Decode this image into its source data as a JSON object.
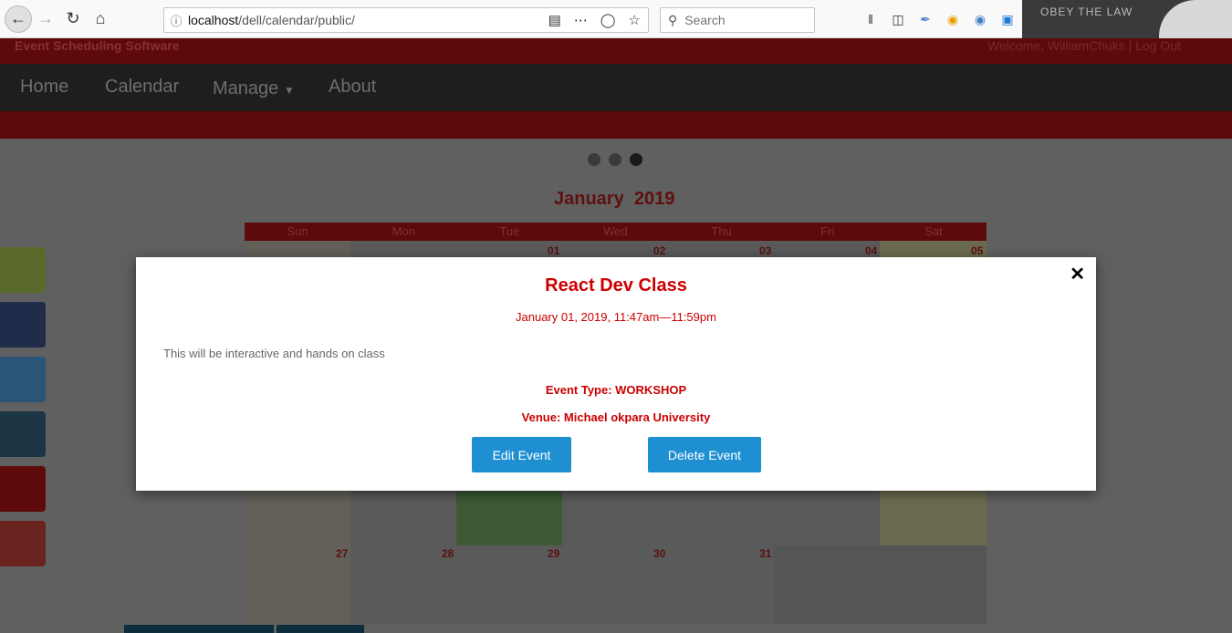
{
  "browser": {
    "url_host": "localhost",
    "url_path": "/dell/calendar/public/",
    "search_placeholder": "Search"
  },
  "header": {
    "brand": "Event Scheduling Software",
    "welcome": "Welcome, WilliamChuks | Log Out"
  },
  "nav": {
    "items": [
      "Home",
      "Calendar",
      "Manage",
      "About"
    ]
  },
  "calendar": {
    "month": "January",
    "year": "2019",
    "weekdays": [
      "Sun",
      "Mon",
      "Tue",
      "Wed",
      "Thu",
      "Fri",
      "Sat"
    ],
    "first_row_days": [
      "01",
      "02",
      "03",
      "04",
      "05"
    ],
    "last_row_days": [
      "27",
      "28",
      "29",
      "30",
      "31"
    ]
  },
  "modal": {
    "title": "React Dev Class",
    "when": "January 01, 2019, 11:47am—11:59pm",
    "description": "This will be interactive and hands on class",
    "event_type": "Event Type: WORKSHOP",
    "venue": "Venue: Michael okpara University",
    "edit_label": "Edit Event",
    "delete_label": "Delete Event",
    "close_symbol": "✕"
  },
  "colors": {
    "accent_red": "#cc0000",
    "button_blue": "#1e90d2"
  }
}
